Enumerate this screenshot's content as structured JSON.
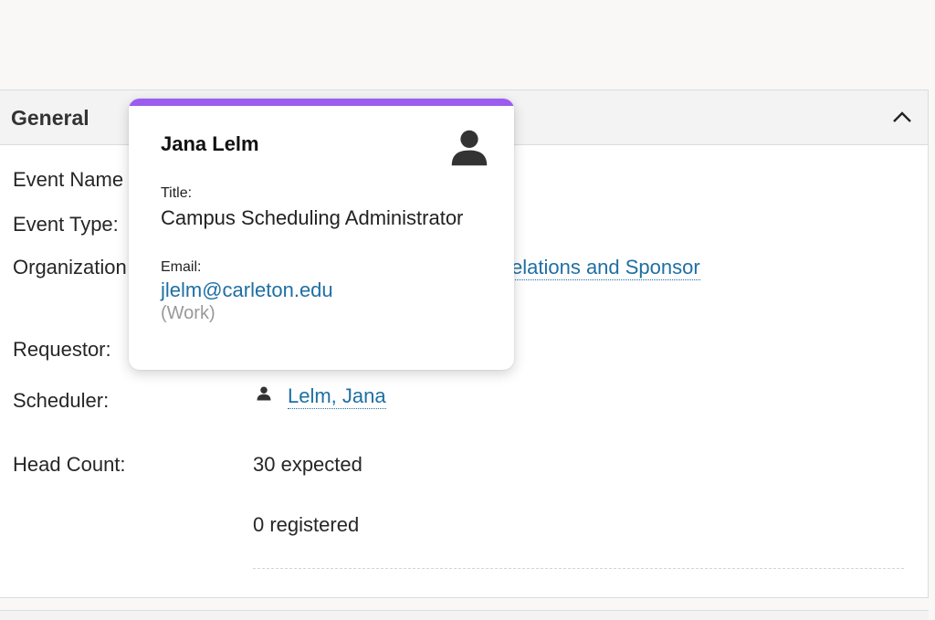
{
  "panel": {
    "title": "General"
  },
  "fields": {
    "event_name_label": "Event Name",
    "event_type_label": "Event Type:",
    "organization_label": "Organization",
    "organization_value": "elations and Sponsor",
    "requestor_label": "Requestor:",
    "scheduler_label": "Scheduler:",
    "scheduler_value": "Lelm, Jana",
    "head_count_label": "Head Count:",
    "expected": "30 expected",
    "registered": "0 registered"
  },
  "popover": {
    "name": "Jana Lelm",
    "title_label": "Title:",
    "title_value": "Campus Scheduling Administrator",
    "email_label": "Email:",
    "email_value": "jlelm@carleton.edu",
    "email_type": "(Work)",
    "accent_color": "#9b5cf0"
  },
  "icons": {
    "avatar": "person-icon",
    "collapse": "chevron-up-icon",
    "scheduler": "person-icon"
  }
}
